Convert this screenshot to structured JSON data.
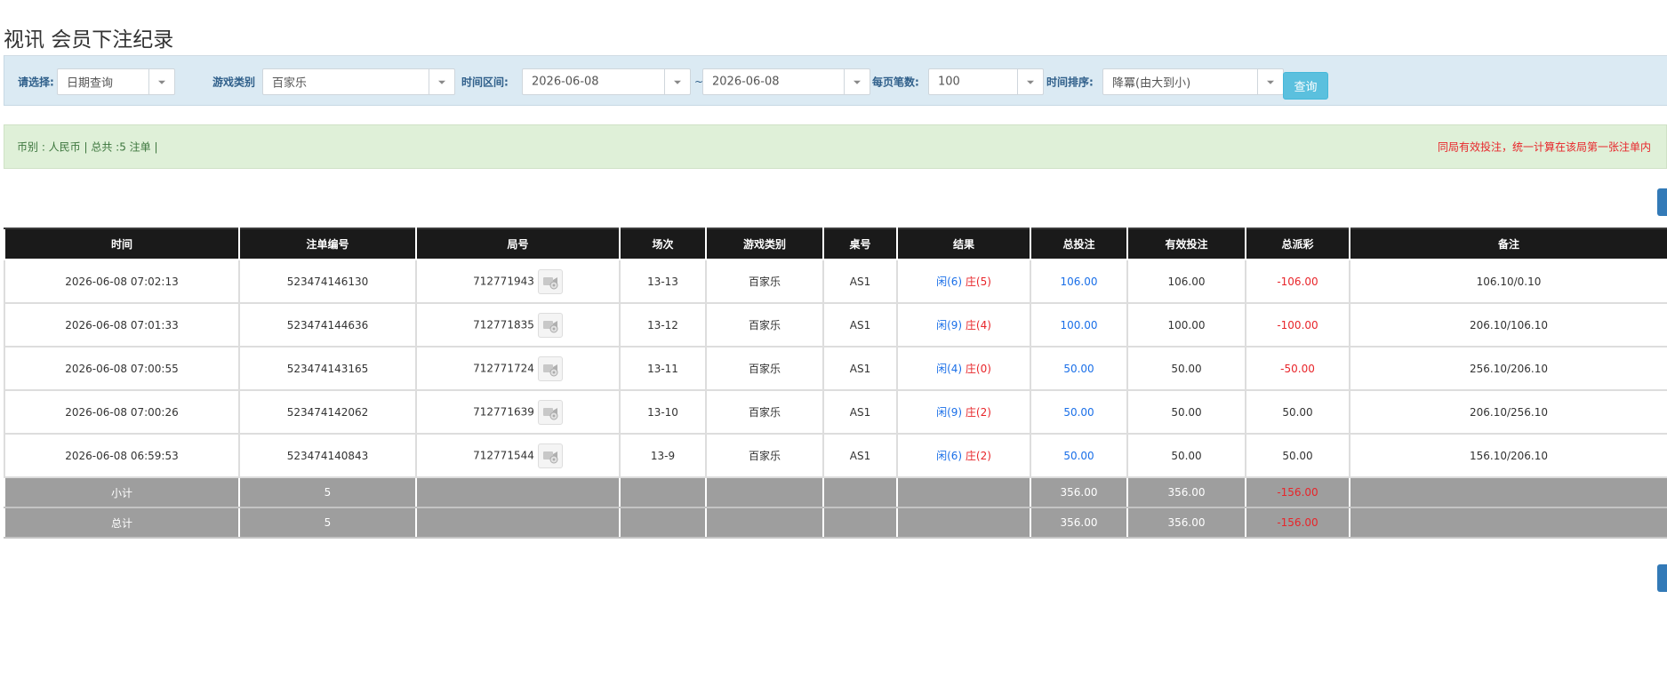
{
  "page": {
    "title": "视讯 会员下注纪录"
  },
  "filters": {
    "select_label": "请选择:",
    "select_value": "日期查询",
    "game_type_label": "游戏类别",
    "game_type_value": "百家乐",
    "time_range_label": "时间区间:",
    "date_from": "2026-06-08",
    "tilde": "~",
    "date_to": "2026-06-08",
    "per_page_label": "每页笔数:",
    "per_page_value": "100",
    "sort_label": "时间排序:",
    "sort_value": "降冪(由大到小)",
    "query_button": "查询"
  },
  "info": {
    "summary": "币别 : 人民币 | 总共 :5 注单 |",
    "notice": "同局有效投注，统一计算在该局第一张注单内"
  },
  "table": {
    "headers": [
      "时间",
      "注单编号",
      "局号",
      "场次",
      "游戏类别",
      "桌号",
      "结果",
      "总投注",
      "有效投注",
      "总派彩",
      "备注"
    ],
    "rows": [
      {
        "time": "2026-06-08 07:02:13",
        "bet_no": "523474146130",
        "round_no": "712771943",
        "session": "13-13",
        "game": "百家乐",
        "table": "AS1",
        "player": "闲(6)",
        "banker": "庄(5)",
        "total_bet": "106.00",
        "valid_bet": "106.00",
        "payout": "-106.00",
        "payout_color": "#e8252a",
        "remark": "106.10/0.10"
      },
      {
        "time": "2026-06-08 07:01:33",
        "bet_no": "523474144636",
        "round_no": "712771835",
        "session": "13-12",
        "game": "百家乐",
        "table": "AS1",
        "player": "闲(9)",
        "banker": "庄(4)",
        "total_bet": "100.00",
        "valid_bet": "100.00",
        "payout": "-100.00",
        "payout_color": "#e8252a",
        "remark": "206.10/106.10"
      },
      {
        "time": "2026-06-08 07:00:55",
        "bet_no": "523474143165",
        "round_no": "712771724",
        "session": "13-11",
        "game": "百家乐",
        "table": "AS1",
        "player": "闲(4)",
        "banker": "庄(0)",
        "total_bet": "50.00",
        "valid_bet": "50.00",
        "payout": "-50.00",
        "payout_color": "#e8252a",
        "remark": "256.10/206.10"
      },
      {
        "time": "2026-06-08 07:00:26",
        "bet_no": "523474142062",
        "round_no": "712771639",
        "session": "13-10",
        "game": "百家乐",
        "table": "AS1",
        "player": "闲(9)",
        "banker": "庄(2)",
        "total_bet": "50.00",
        "valid_bet": "50.00",
        "payout": "50.00",
        "payout_color": "#333333",
        "remark": "206.10/256.10"
      },
      {
        "time": "2026-06-08 06:59:53",
        "bet_no": "523474140843",
        "round_no": "712771544",
        "session": "13-9",
        "game": "百家乐",
        "table": "AS1",
        "player": "闲(6)",
        "banker": "庄(2)",
        "total_bet": "50.00",
        "valid_bet": "50.00",
        "payout": "50.00",
        "payout_color": "#333333",
        "remark": "156.10/206.10"
      }
    ],
    "subtotal": {
      "label": "小计",
      "count": "5",
      "total_bet": "356.00",
      "valid_bet": "356.00",
      "payout": "-156.00"
    },
    "total": {
      "label": "总计",
      "count": "5",
      "total_bet": "356.00",
      "valid_bet": "356.00",
      "payout": "-156.00"
    }
  },
  "icons": {
    "video": "video-replay-icon"
  },
  "colors": {
    "header_bg": "#1a1a1a",
    "sum_bg": "#9e9e9e",
    "negative": "#e8252a",
    "bet_blue": "#1a6fe8",
    "filter_bg": "#dbeaf3",
    "info_bg": "#dff0d8"
  }
}
